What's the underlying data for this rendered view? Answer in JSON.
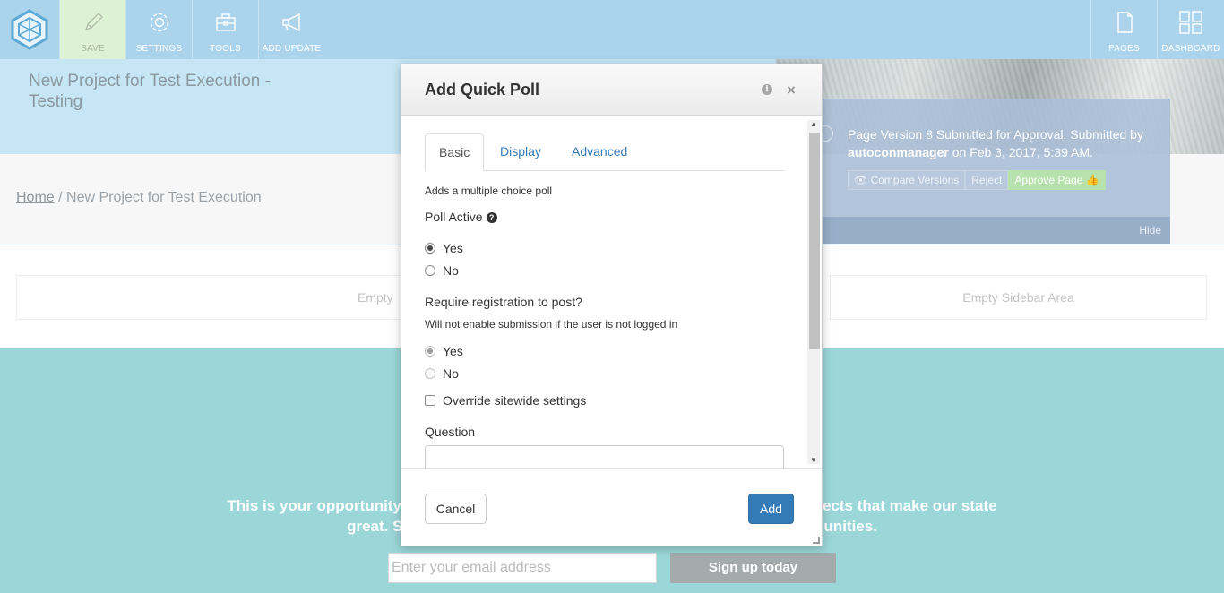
{
  "toolbar": {
    "items": [
      {
        "label": "SAVE",
        "icon": "pencil-icon"
      },
      {
        "label": "SETTINGS",
        "icon": "gear-icon"
      },
      {
        "label": "TOOLS",
        "icon": "toolbox-icon"
      },
      {
        "label": "ADD UPDATE",
        "icon": "megaphone-icon"
      }
    ],
    "right_items": [
      {
        "label": "PAGES",
        "icon": "page-icon"
      },
      {
        "label": "DASHBOARD",
        "icon": "dashboard-icon"
      }
    ],
    "colors": {
      "bar": "#abd4ec",
      "save_active": "#ddf1d3"
    }
  },
  "page": {
    "title": "New Project for Test Execution - Testing",
    "breadcrumb_home": "Home",
    "breadcrumb_current": "/ New Project for Test Execution",
    "empty_main": "Empty",
    "empty_sidebar": "Empty Sidebar Area"
  },
  "approval": {
    "message_prefix": "Page Version 8 Submitted for Approval. Submitted by",
    "user": "autoconmanager",
    "message_suffix": "on Feb 3, 2017, 5:39 AM.",
    "compare": "Compare Versions",
    "reject": "Reject",
    "approve": "Approve Page",
    "hide": "Hide"
  },
  "banner": {
    "text_left": "This is your opportunity",
    "text_right": "ects that make our state",
    "text_line2_left": "great. S",
    "text_line2_right": "unities.",
    "email_placeholder": "Enter your email address",
    "signup": "Sign up today",
    "color": "#9bd6d8"
  },
  "modal": {
    "title": "Add Quick Poll",
    "tabs": [
      {
        "label": "Basic",
        "active": true
      },
      {
        "label": "Display",
        "active": false
      },
      {
        "label": "Advanced",
        "active": false
      }
    ],
    "description": "Adds a multiple choice poll",
    "poll_active_label": "Poll Active",
    "poll_active_options": [
      "Yes",
      "No"
    ],
    "poll_active_selected": "Yes",
    "require_reg_label": "Require registration to post?",
    "require_reg_help": "Will not enable submission if the user is not logged in",
    "require_reg_options": [
      "Yes",
      "No"
    ],
    "require_reg_selected": "Yes",
    "override_label": "Override sitewide settings",
    "override_checked": false,
    "question_label": "Question",
    "question_value": "",
    "cancel": "Cancel",
    "add": "Add",
    "primary_color": "#337ab7"
  }
}
